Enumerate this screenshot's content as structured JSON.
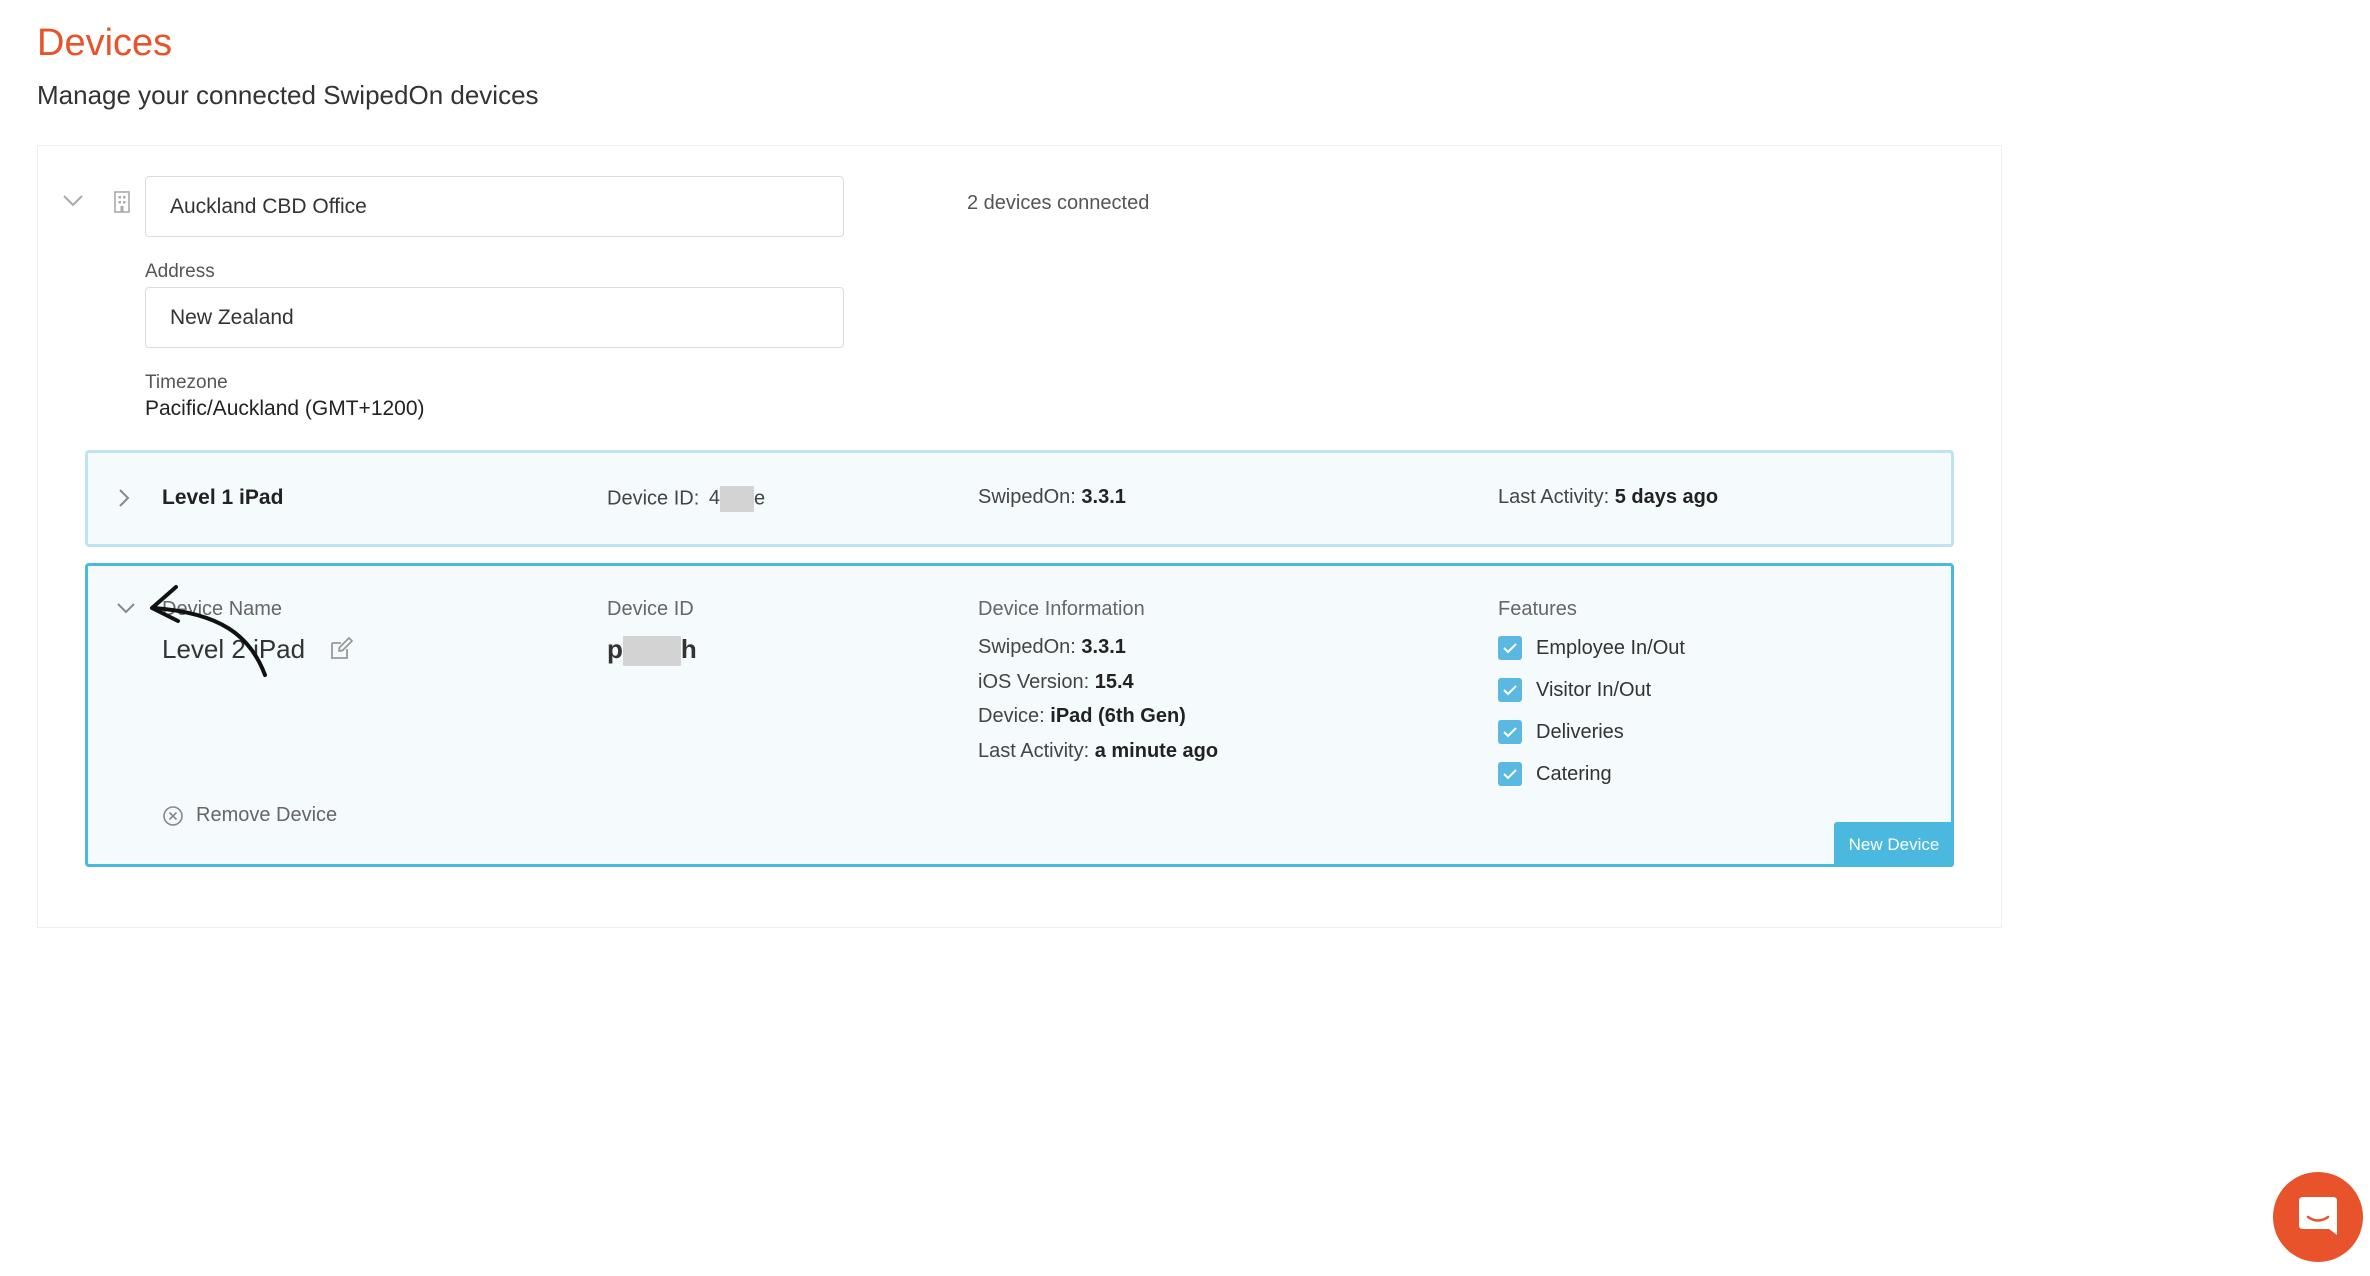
{
  "header": {
    "title": "Devices",
    "subtitle": "Manage your connected SwipedOn devices"
  },
  "location": {
    "name": "Auckland CBD Office",
    "address_label": "Address",
    "address": "New Zealand",
    "timezone_label": "Timezone",
    "timezone": "Pacific/Auckland (GMT+1200)",
    "devices_connected": "2 devices connected"
  },
  "devices": {
    "collapsed": {
      "name": "Level 1 iPad",
      "device_id_label": "Device ID:",
      "device_id_start": "4",
      "device_id_end": "e",
      "swipedon_label": "SwipedOn:",
      "swipedon_version": "3.3.1",
      "last_activity_label": "Last Activity:",
      "last_activity": "5 days ago"
    },
    "expanded": {
      "name_label": "Device Name",
      "name": "Level 2 iPad",
      "device_id_label": "Device ID",
      "device_id_start": "p",
      "device_id_end": "h",
      "info_label": "Device Information",
      "swipedon_label": "SwipedOn:",
      "swipedon_version": "3.3.1",
      "ios_label": "iOS Version:",
      "ios_version": "15.4",
      "device_label": "Device:",
      "device_model": "iPad (6th Gen)",
      "last_activity_label": "Last Activity:",
      "last_activity": "a minute ago",
      "features_label": "Features",
      "features": [
        {
          "label": "Employee In/Out",
          "checked": true
        },
        {
          "label": "Visitor In/Out",
          "checked": true
        },
        {
          "label": "Deliveries",
          "checked": true
        },
        {
          "label": "Catering",
          "checked": true
        }
      ],
      "remove_label": "Remove Device",
      "badge": "New Device"
    }
  },
  "colors": {
    "accent": "#e8532b",
    "primary_blue": "#4bb8df",
    "row_border": "#bfe3f1",
    "card_bg": "#f5fafd"
  },
  "icons": {
    "location_toggle": "chevron-down-icon",
    "location": "building-icon",
    "row_toggle": "chevron-right-icon",
    "card_toggle": "chevron-down-icon",
    "edit": "edit-icon",
    "remove": "remove-circle-icon",
    "check": "check-icon",
    "chat": "chat-icon"
  }
}
